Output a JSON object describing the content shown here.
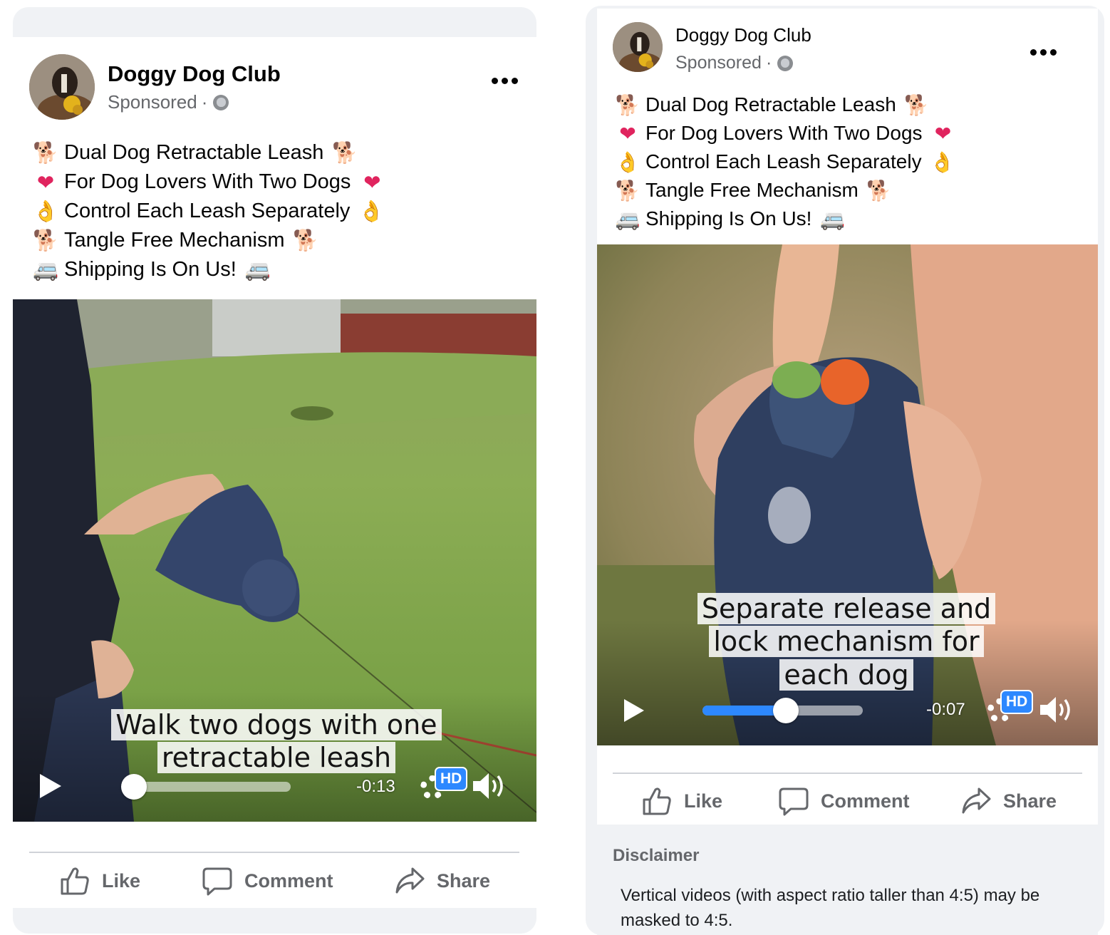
{
  "ads": [
    {
      "page_name": "Doggy Dog Club",
      "sponsored_label": "Sponsored",
      "separator": "·",
      "lines": [
        {
          "lead": "🐕",
          "text": "Dual Dog Retractable Leash",
          "trail": "🐕"
        },
        {
          "lead": "❤",
          "text": "For Dog Lovers With Two Dogs",
          "trail": "❤"
        },
        {
          "lead": "👌",
          "text": "Control Each Leash Separately",
          "trail": "👌"
        },
        {
          "lead": "🐕",
          "text": "Tangle Free Mechanism",
          "trail": "🐕"
        },
        {
          "lead": "🚐",
          "text": "Shipping Is On Us!",
          "trail": "🚐"
        }
      ],
      "video": {
        "caption": "Walk two dogs with one retractable leash",
        "remaining_time": "-0:13",
        "progress": 0.0,
        "quality_badge": "HD"
      },
      "actions": {
        "like": "Like",
        "comment": "Comment",
        "share": "Share"
      }
    },
    {
      "page_name": "Doggy Dog Club",
      "sponsored_label": "Sponsored",
      "separator": "·",
      "lines": [
        {
          "lead": "🐕",
          "text": "Dual Dog Retractable Leash",
          "trail": "🐕"
        },
        {
          "lead": "❤",
          "text": "For Dog Lovers With Two Dogs",
          "trail": "❤"
        },
        {
          "lead": "👌",
          "text": "Control Each Leash Separately",
          "trail": "👌"
        },
        {
          "lead": "🐕",
          "text": "Tangle Free Mechanism",
          "trail": "🐕"
        },
        {
          "lead": "🚐",
          "text": "Shipping Is On Us!",
          "trail": "🚐"
        }
      ],
      "video": {
        "caption": "Separate release and lock mechanism for each dog",
        "remaining_time": "-0:07",
        "progress": 0.52,
        "quality_badge": "HD"
      },
      "actions": {
        "like": "Like",
        "comment": "Comment",
        "share": "Share"
      }
    }
  ],
  "disclaimer": {
    "title": "Disclaimer",
    "text": "Vertical videos (with aspect ratio taller than 4:5) may be masked to 4:5."
  },
  "colors": {
    "accent": "#2d88ff",
    "heart": "#e0245e",
    "secondary_text": "#65676b"
  },
  "icons": [
    "globe-icon",
    "more-options-icon",
    "play-icon",
    "settings-gear-icon",
    "hd-badge",
    "volume-icon",
    "like-icon",
    "comment-icon",
    "share-icon"
  ]
}
